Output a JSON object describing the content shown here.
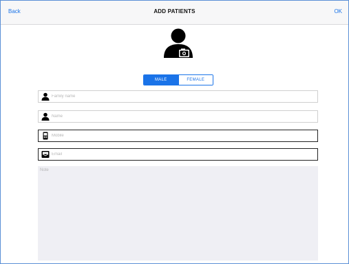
{
  "navbar": {
    "back_label": "Back",
    "title": "ADD PATIENTS",
    "ok_label": "OK"
  },
  "gender": {
    "options": [
      "MALE",
      "FEMALE"
    ],
    "selected": "MALE"
  },
  "form": {
    "family_name_placeholder": "Family name",
    "name_placeholder": "Name",
    "mobile_placeholder": "Mobile",
    "email_placeholder": "Email",
    "note_placeholder": "Note"
  },
  "colors": {
    "accent": "#1a73e8",
    "note_bg": "#efeff4"
  },
  "icons": {
    "avatar": "person-camera-icon",
    "family_name": "person-icon",
    "name": "person-icon",
    "mobile": "phone-icon",
    "email": "mail-icon"
  }
}
